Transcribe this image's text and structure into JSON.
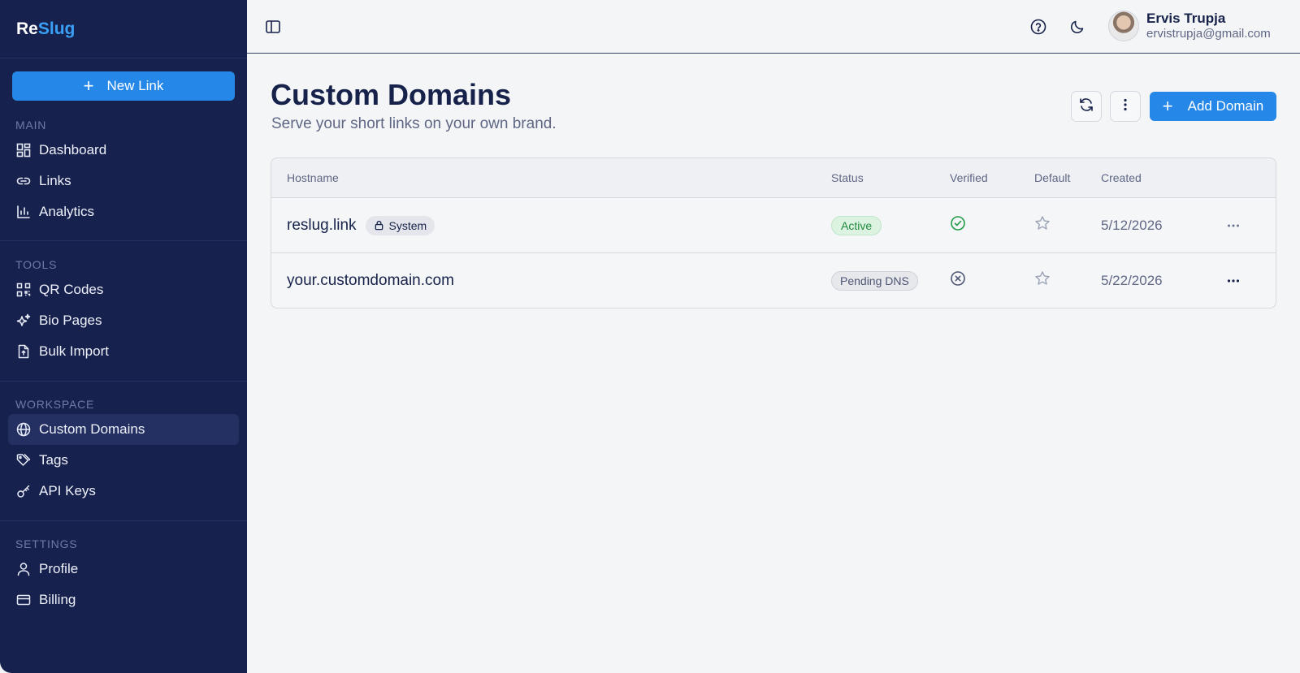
{
  "brand": {
    "part1": "Re",
    "part2": "Slug"
  },
  "sidebar": {
    "new_link_label": "New Link",
    "sections": [
      {
        "title": "MAIN",
        "items": [
          {
            "label": "Dashboard",
            "icon": "dashboard-icon"
          },
          {
            "label": "Links",
            "icon": "link-icon"
          },
          {
            "label": "Analytics",
            "icon": "bar-chart-icon"
          }
        ]
      },
      {
        "title": "TOOLS",
        "items": [
          {
            "label": "QR Codes",
            "icon": "qr-code-icon"
          },
          {
            "label": "Bio Pages",
            "icon": "sparkles-icon"
          },
          {
            "label": "Bulk Import",
            "icon": "file-upload-icon"
          }
        ]
      },
      {
        "title": "WORKSPACE",
        "items": [
          {
            "label": "Custom Domains",
            "icon": "globe-icon",
            "active": true
          },
          {
            "label": "Tags",
            "icon": "tags-icon"
          },
          {
            "label": "API Keys",
            "icon": "key-icon"
          }
        ]
      },
      {
        "title": "SETTINGS",
        "items": [
          {
            "label": "Profile",
            "icon": "user-icon"
          },
          {
            "label": "Billing",
            "icon": "credit-card-icon"
          }
        ]
      }
    ]
  },
  "topbar": {
    "user_name": "Ervis Trupja",
    "user_email": "ervistrupja@gmail.com"
  },
  "page": {
    "title": "Custom Domains",
    "subtitle": "Serve your short links on your own brand.",
    "add_domain_label": "Add Domain"
  },
  "table": {
    "headers": {
      "hostname": "Hostname",
      "status": "Status",
      "verified": "Verified",
      "default": "Default",
      "created": "Created"
    },
    "rows": [
      {
        "hostname": "reslug.link",
        "badge": "System",
        "status": "Active",
        "verified": true,
        "default": false,
        "created": "5/12/2026"
      },
      {
        "hostname": "your.customdomain.com",
        "badge": "",
        "status": "Pending DNS",
        "verified": false,
        "default": false,
        "created": "5/22/2026"
      }
    ]
  },
  "colors": {
    "accent": "#2587e8",
    "sidebar_bg": "#17214e",
    "success": "#1f8a3b"
  }
}
